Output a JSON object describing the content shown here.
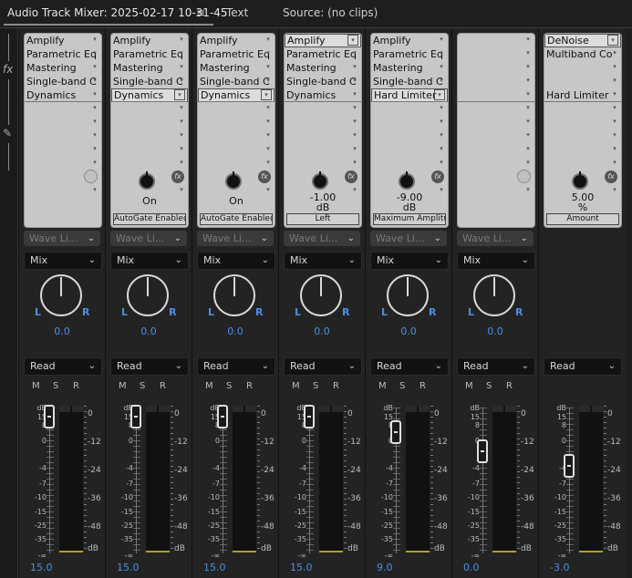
{
  "header": {
    "tabs": [
      {
        "label": "Audio Track Mixer: 2025-02-17 10-31-45"
      },
      {
        "label": "Text"
      },
      {
        "label": "Source: (no clips)"
      }
    ],
    "menu_icon": "hamburger-menu-icon"
  },
  "leftbar": {
    "fx_label": "fx",
    "fx_icon": "fx-icon",
    "send_icon": "pen-send-icon"
  },
  "labels": {
    "wave": "Wave Li...",
    "mix": "Mix",
    "read": "Read",
    "m": "M",
    "s": "S",
    "r": "R",
    "L": "L",
    "R": "R",
    "db": "dB"
  },
  "fader_scale": [
    "dB",
    "15",
    "8",
    "0",
    "-4",
    "-7",
    "-10",
    "-15",
    "-25",
    "-35",
    "-∞"
  ],
  "meter_scale": [
    "0",
    "-12",
    "-24",
    "-36",
    "-48",
    "dB"
  ],
  "channels": [
    {
      "effects": [
        "Amplify",
        "Parametric Eq",
        "Mastering",
        "Single-band C",
        "Dynamics"
      ],
      "selected_slot": -1,
      "knob": false,
      "param_value": "",
      "param_unit": "",
      "param_dropdown": "",
      "pan": "0.0",
      "volume": "15.0",
      "fader_level": 0.97,
      "has_wave": true,
      "has_mix": true,
      "has_msr": true
    },
    {
      "effects": [
        "Amplify",
        "Parametric Eq",
        "Mastering",
        "Single-band C",
        "Dynamics"
      ],
      "selected_slot": 4,
      "knob": true,
      "param_value": "On",
      "param_unit": "",
      "param_dropdown": "AutoGate Enabled",
      "pan": "0.0",
      "volume": "15.0",
      "fader_level": 0.97,
      "has_wave": true,
      "has_mix": true,
      "has_msr": true
    },
    {
      "effects": [
        "Amplify",
        "Parametric Eq",
        "Mastering",
        "Single-band C",
        "Dynamics"
      ],
      "selected_slot": 4,
      "knob": true,
      "param_value": "On",
      "param_unit": "",
      "param_dropdown": "AutoGate Enabled",
      "pan": "0.0",
      "volume": "15.0",
      "fader_level": 0.97,
      "has_wave": true,
      "has_mix": true,
      "has_msr": true
    },
    {
      "effects": [
        "Amplify",
        "Parametric Eq",
        "Mastering",
        "Single-band C",
        "Dynamics"
      ],
      "selected_slot": 0,
      "knob": true,
      "param_value": "-1.00",
      "param_unit": "dB",
      "param_dropdown": "Left",
      "pan": "0.0",
      "volume": "15.0",
      "fader_level": 0.97,
      "has_wave": true,
      "has_mix": true,
      "has_msr": true
    },
    {
      "effects": [
        "Amplify",
        "Parametric Eq",
        "Mastering",
        "Single-band C",
        "Hard Limiter"
      ],
      "selected_slot": 4,
      "knob": true,
      "param_value": "-9.00",
      "param_unit": "dB",
      "param_dropdown": "Maximum Amplitude",
      "pan": "0.0",
      "volume": "9.0",
      "fader_level": 0.84,
      "has_wave": true,
      "has_mix": true,
      "has_msr": true
    },
    {
      "effects": [
        "",
        "",
        "",
        "",
        ""
      ],
      "selected_slot": -1,
      "knob": false,
      "param_value": "",
      "param_unit": "",
      "param_dropdown": "",
      "pan": "0.0",
      "volume": "0.0",
      "fader_level": 0.69,
      "has_wave": true,
      "has_mix": true,
      "has_msr": true
    },
    {
      "effects": [
        "DeNoise",
        "Multiband Co",
        "",
        "",
        "Hard Limiter"
      ],
      "selected_slot": 0,
      "knob": true,
      "param_value": "5.00",
      "param_unit": "%",
      "param_dropdown": "Amount",
      "pan": "",
      "volume": "-3.0",
      "fader_level": 0.57,
      "has_wave": false,
      "has_mix": false,
      "has_msr": false
    }
  ]
}
